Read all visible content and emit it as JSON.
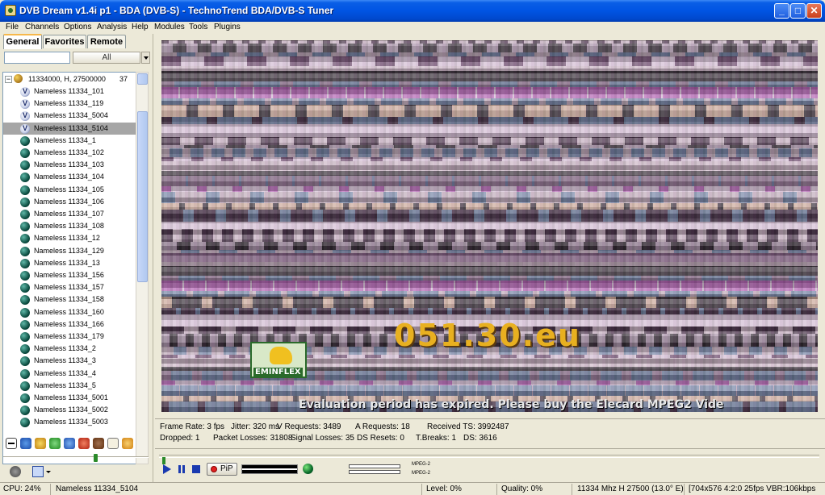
{
  "window": {
    "title": "DVB Dream v1.4i p1 - BDA (DVB-S)  -  TechnoTrend BDA/DVB-S Tuner",
    "minimize": "_",
    "maximize": "□",
    "close": "✕"
  },
  "menu": [
    "File",
    "Channels",
    "Options",
    "Analysis",
    "Help",
    "Modules",
    "Tools",
    "Plugins"
  ],
  "tabs": [
    "General",
    "Favorites",
    "Remote"
  ],
  "filter": {
    "search_value": "",
    "selected": "All"
  },
  "tree": {
    "root_label": "11334000, H, 27500000",
    "root_count": "37",
    "expander": "−",
    "channels": [
      {
        "label": "Nameless 11334_101",
        "icon": "v"
      },
      {
        "label": "Nameless 11334_119",
        "icon": "v"
      },
      {
        "label": "Nameless 11334_5004",
        "icon": "v"
      },
      {
        "label": "Nameless 11334_5104",
        "icon": "v"
      },
      {
        "label": "Nameless 11334_1",
        "icon": "tv"
      },
      {
        "label": "Nameless 11334_102",
        "icon": "tv"
      },
      {
        "label": "Nameless 11334_103",
        "icon": "tv"
      },
      {
        "label": "Nameless 11334_104",
        "icon": "tv"
      },
      {
        "label": "Nameless 11334_105",
        "icon": "tv"
      },
      {
        "label": "Nameless 11334_106",
        "icon": "tv"
      },
      {
        "label": "Nameless 11334_107",
        "icon": "tv"
      },
      {
        "label": "Nameless 11334_108",
        "icon": "tv"
      },
      {
        "label": "Nameless 11334_12",
        "icon": "tv"
      },
      {
        "label": "Nameless 11334_129",
        "icon": "tv"
      },
      {
        "label": "Nameless 11334_13",
        "icon": "tv"
      },
      {
        "label": "Nameless 11334_156",
        "icon": "tv"
      },
      {
        "label": "Nameless 11334_157",
        "icon": "tv"
      },
      {
        "label": "Nameless 11334_158",
        "icon": "tv"
      },
      {
        "label": "Nameless 11334_160",
        "icon": "tv"
      },
      {
        "label": "Nameless 11334_166",
        "icon": "tv"
      },
      {
        "label": "Nameless 11334_179",
        "icon": "tv"
      },
      {
        "label": "Nameless 11334_2",
        "icon": "tv"
      },
      {
        "label": "Nameless 11334_3",
        "icon": "tv"
      },
      {
        "label": "Nameless 11334_4",
        "icon": "tv"
      },
      {
        "label": "Nameless 11334_5",
        "icon": "tv"
      },
      {
        "label": "Nameless 11334_5001",
        "icon": "tv"
      },
      {
        "label": "Nameless 11334_5002",
        "icon": "tv"
      },
      {
        "label": "Nameless 11334_5003",
        "icon": "tv"
      }
    ],
    "selected_channel": "Nameless 11334_5104"
  },
  "video": {
    "logo_text": "EMINFLEX",
    "domain_text": "051.30.eu",
    "eval_text": "Evaluation period has expired. Please buy the Elecard MPEG2 Vide"
  },
  "stats": {
    "frame_rate": "Frame Rate: 3 fps",
    "jitter": "Jitter: 320 ms",
    "v_requests": "V Requests: 3489",
    "a_requests": "A Requests: 18",
    "received_ts": "Received TS: 3992487",
    "dropped": "Dropped: 1",
    "packet_losses": "Packet Losses: 31808",
    "signal_losses": "Signal Losses: 35",
    "ds_resets": "DS Resets: 0",
    "t_breaks": "T.Breaks: 1",
    "ds": "DS: 3616"
  },
  "playback": {
    "pip_label": "PiP",
    "codec_video": "MPEG-2",
    "codec_audio": "MPEG-2"
  },
  "status": {
    "cpu": "CPU: 24%",
    "channel": "Nameless 11334_5104",
    "level": "Level: 0%",
    "quality": "Quality: 0%",
    "tuning": "11334 Mhz  H  27500  (13.0° E)",
    "format": "[704x576 4:2:0 25fps  VBR:106kbps"
  },
  "colors": {
    "titlebar": "#0054e3",
    "chrome": "#ece9d8",
    "selection": "#a6a6a6",
    "control_blue": "#1a3ab0"
  }
}
